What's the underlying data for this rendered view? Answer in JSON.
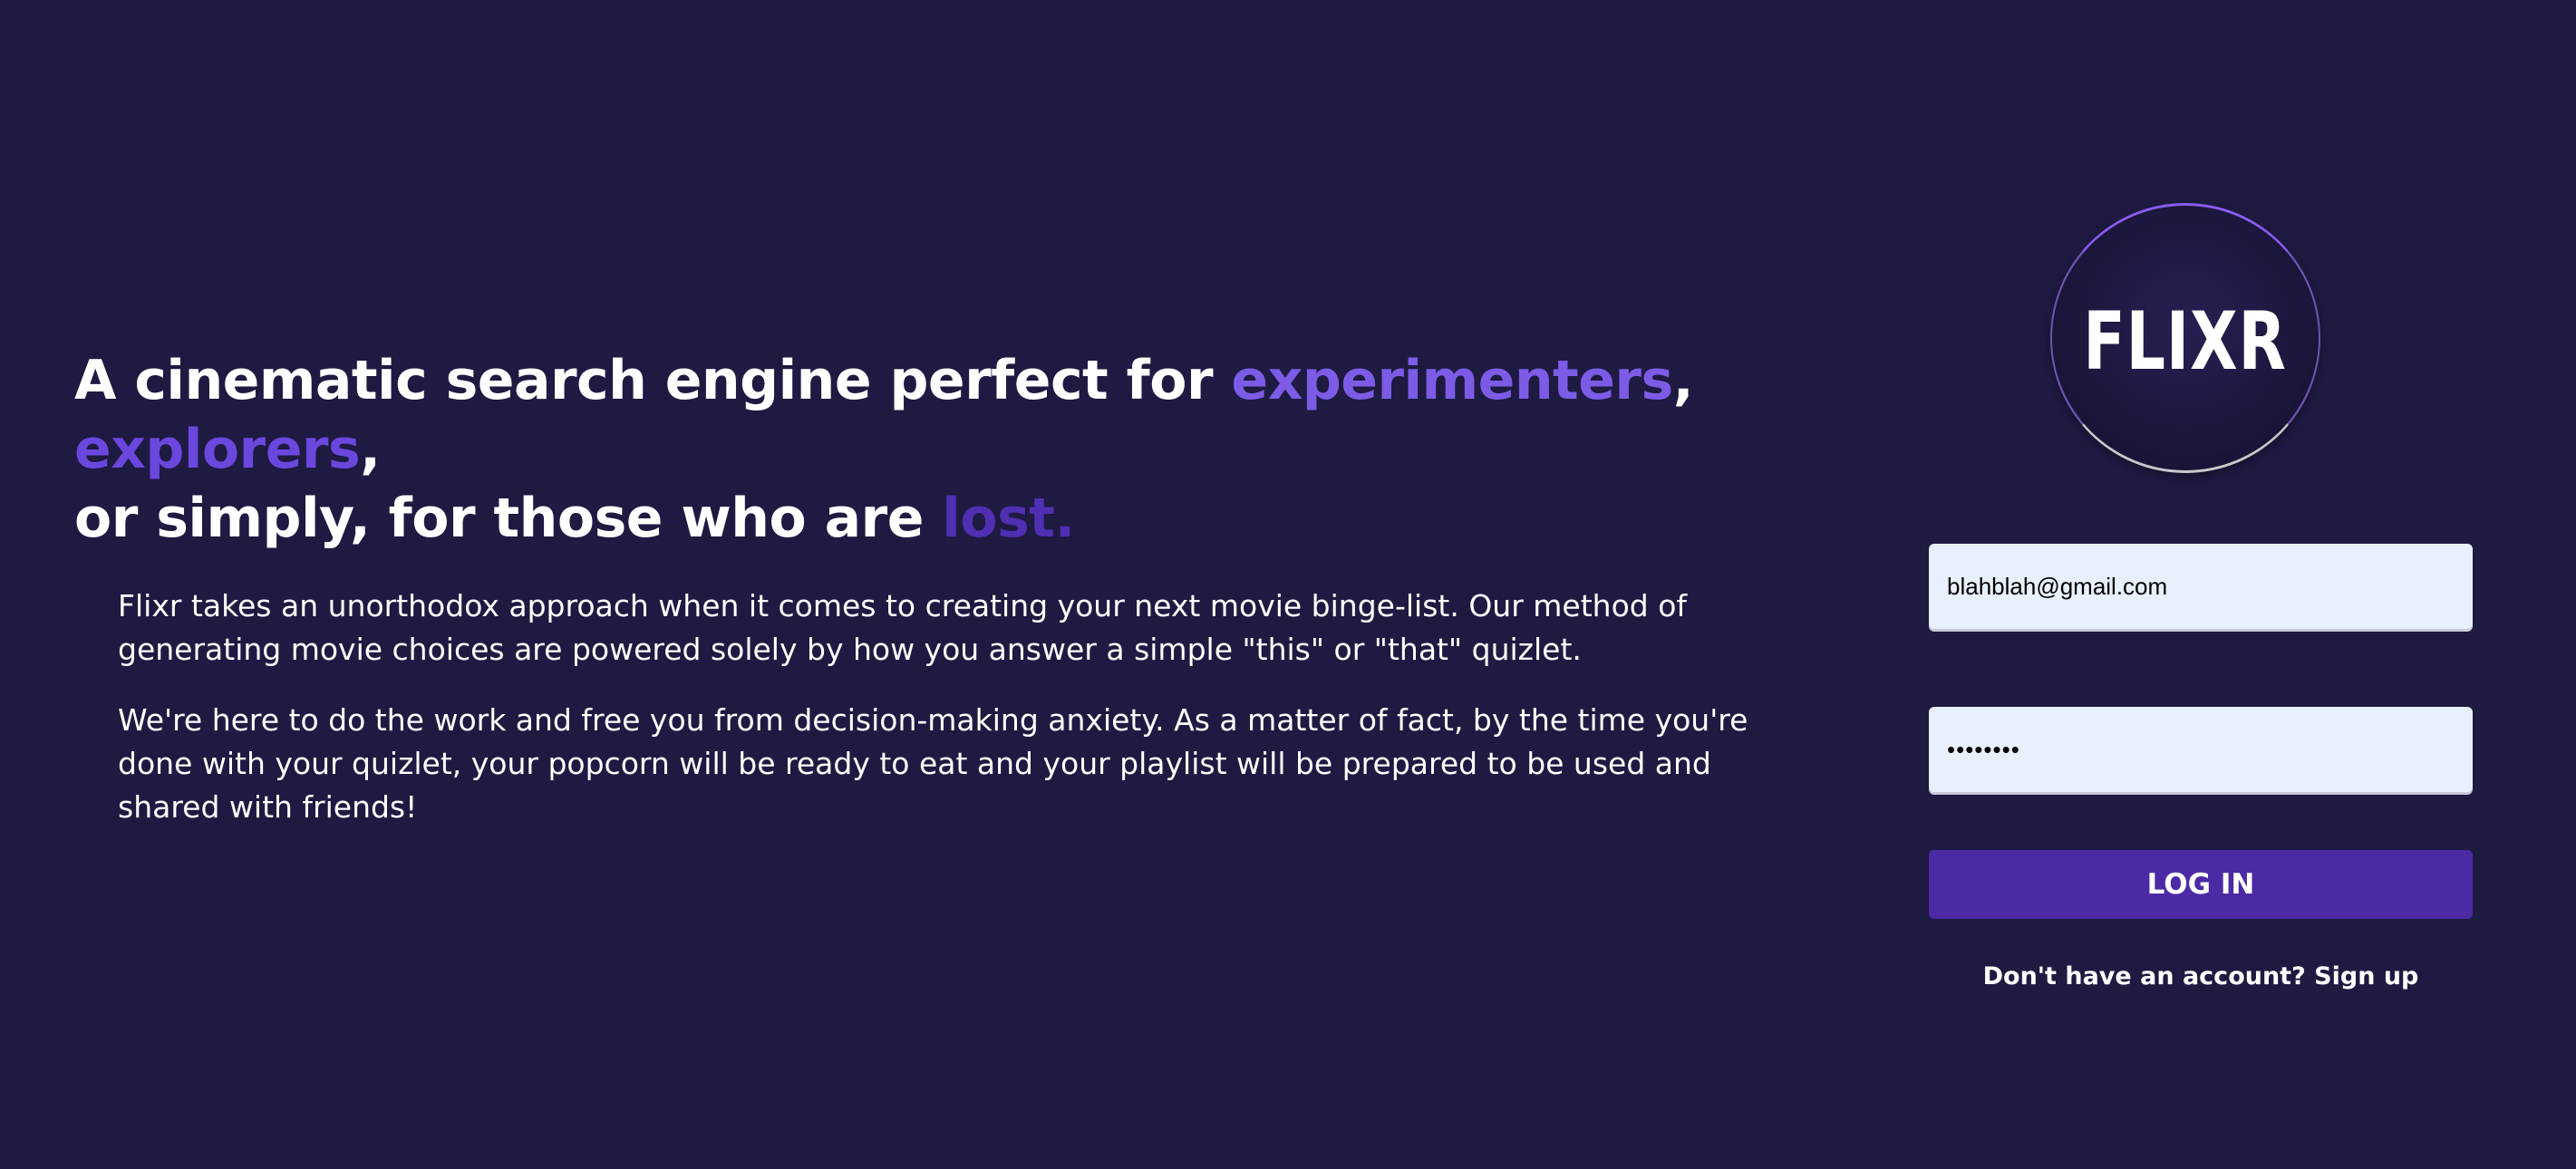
{
  "hero": {
    "part1": "A cinematic search engine perfect for ",
    "highlight1": "experimenters",
    "sep1": ", ",
    "highlight2": "explorers",
    "sep2": ",",
    "part2": "or simply, for those who are ",
    "highlight3": "lost."
  },
  "description": {
    "paragraph1": "Flixr takes an unorthodox approach when it comes to creating your next movie binge-list. Our method of generating movie choices are powered solely by how you answer a simple \"this\" or \"that\" quizlet.",
    "paragraph2": "We're here to do the work and free you from decision-making anxiety. As a matter of fact, by the time you're done with your quizlet, your popcorn will be ready to eat and your playlist will be prepared to be used and shared with friends!"
  },
  "login": {
    "logo_text": "FLIXR",
    "email_value": "blahblah@gmail.com",
    "password_value": "••••••••",
    "button_label": "LOG IN",
    "signup_prompt": "Don't have an account?",
    "signup_link": "Sign up"
  },
  "colors": {
    "background": "#1e1a42",
    "highlight_experimenters": "#7c5ce6",
    "highlight_explorers": "#6a47dd",
    "highlight_lost": "#4f2fb2",
    "button": "#4b2aa6",
    "input_background": "#e8f0fe"
  }
}
